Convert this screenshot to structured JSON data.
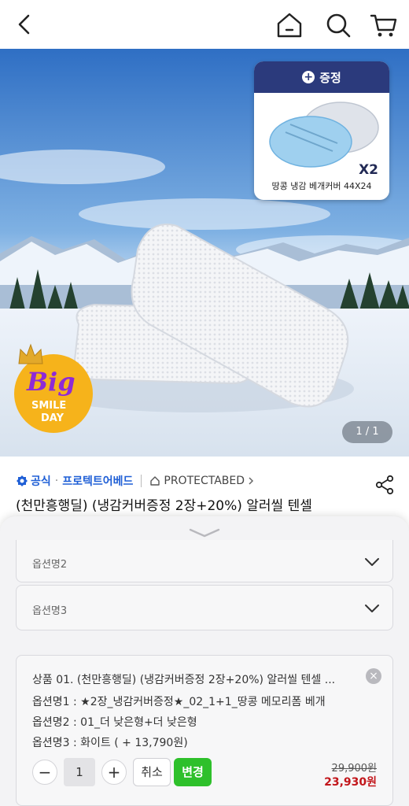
{
  "header": {
    "icons": [
      "back-icon",
      "home-icon",
      "search-icon",
      "cart-icon"
    ]
  },
  "hero": {
    "page_indicator": "1 / 1",
    "gift": {
      "header": "증정",
      "multiplier": "X2",
      "name": "땅콩 냉감 베개커버 44X24"
    },
    "badge": {
      "line1": "Big",
      "line2": "SMILE",
      "line3": "DAY"
    }
  },
  "product": {
    "official": "공식",
    "brand": "프로텍트어베드",
    "store": "PROTECTABED",
    "title": "(천만흥행딜) (냉감커버증정 2장+20%) 알러씰 텐셀"
  },
  "options": {
    "option2_label": "옵션명2",
    "option3_label": "옵션명3"
  },
  "selected": {
    "product_line": "상품 01. (천만흥행딜) (냉감커버증정 2장+20%) 알러씰 텐셀 ...",
    "option1": "옵션명1 : ★2장_냉감커버증정★_02_1+1_땅콩 메모리폼 베개",
    "option2": "옵션명2 : 01_더 낮은형+더 낮은형",
    "option3": "옵션명3 : 화이트 ( + 13,790원)",
    "quantity": "1",
    "cancel_label": "취소",
    "change_label": "변경",
    "original_price": "29,900원",
    "sale_price": "23,930원"
  },
  "colors": {
    "accent_blue": "#1f5fd6",
    "gift_header": "#2b3a7c",
    "change_green": "#2ec02b",
    "sale_red": "#c2161b"
  }
}
